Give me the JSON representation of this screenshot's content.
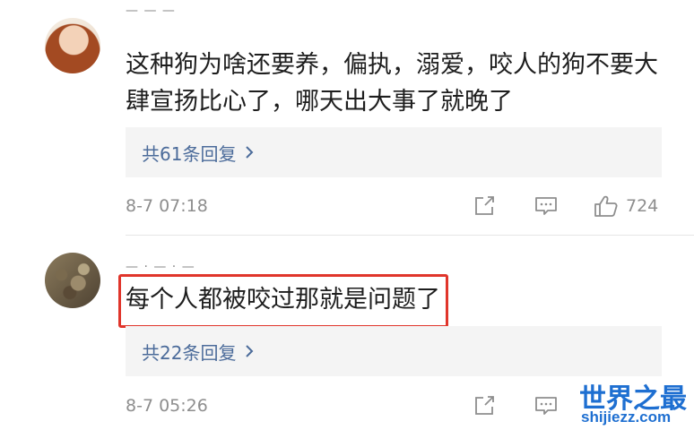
{
  "comments": [
    {
      "username": "—  —  —",
      "text": "这种狗为啥还要养，偏执，溺爱，咬人的狗不要大肆宣扬比心了，哪天出大事了就晚了",
      "replies_label": "共61条回复",
      "timestamp": "8-7 07:18",
      "likes": "724"
    },
    {
      "username": "—  ·  —  ·  —",
      "text": "每个人都被咬过那就是问题了",
      "replies_label": "共22条回复",
      "timestamp": "8-7 05:26",
      "likes": ""
    }
  ],
  "watermark": {
    "title": "世界之最",
    "url": "shijiezz.com"
  },
  "colors": {
    "reply_link": "#4b6b9a",
    "highlight": "#e0352b",
    "watermark": "#1e6fd1",
    "meta": "#8e8e8e"
  },
  "icons": [
    "share-icon",
    "comment-icon",
    "like-icon",
    "chevron-right-icon"
  ]
}
